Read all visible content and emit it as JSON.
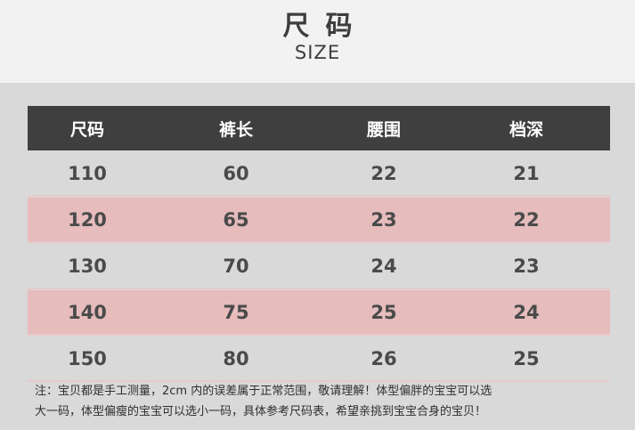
{
  "header": {
    "title": "尺码",
    "subtitle": "SIZE"
  },
  "table": {
    "columns": [
      "尺码",
      "裤长",
      "腰围",
      "档深"
    ],
    "rows": [
      [
        "110",
        "60",
        "22",
        "21"
      ],
      [
        "120",
        "65",
        "23",
        "22"
      ],
      [
        "130",
        "70",
        "24",
        "23"
      ],
      [
        "140",
        "75",
        "25",
        "24"
      ],
      [
        "150",
        "80",
        "26",
        "25"
      ]
    ],
    "stripe_color": "#e6bcbc",
    "header_color": "#3f3f3f"
  },
  "note": {
    "line1": "注：宝贝都是手工测量，2cm 内的误差属于正常范围，敬请理解！体型偏胖的宝宝可以选",
    "line2": "大一码，体型偏瘦的宝宝可以选小一码，具体参考尺码表，希望亲挑到宝宝合身的宝贝！"
  }
}
